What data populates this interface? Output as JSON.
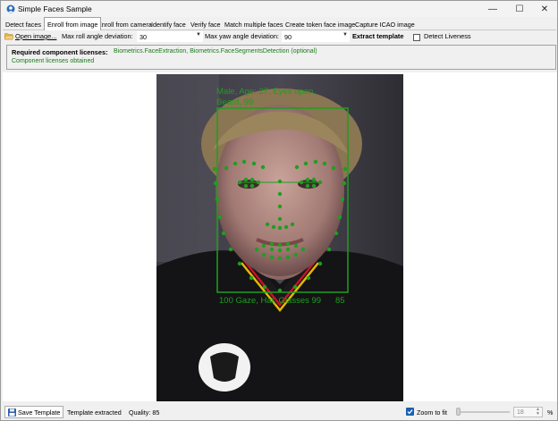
{
  "window": {
    "title": "Simple Faces Sample",
    "minimize": "—",
    "maximize": "☐",
    "close": "✕"
  },
  "tabs": [
    {
      "label": "Detect faces",
      "active": false
    },
    {
      "label": "Enroll from image",
      "active": true
    },
    {
      "label": "Enroll from camera",
      "active": false
    },
    {
      "label": "Identify face",
      "active": false
    },
    {
      "label": "Verify face",
      "active": false
    },
    {
      "label": "Match multiple faces",
      "active": false
    },
    {
      "label": "Create token face image",
      "active": false
    },
    {
      "label": "Capture ICAO image",
      "active": false
    }
  ],
  "toolbar": {
    "open_label": "Open image...",
    "roll_label": "Max roll angle deviation:",
    "roll_value": "30",
    "yaw_label": "Max yaw angle deviation:",
    "yaw_value": "90",
    "extract_label": "Extract template",
    "liveness_label": "Detect Liveness",
    "liveness_checked": false
  },
  "licenses": {
    "label": "Required component licenses:",
    "value": "Biometrics.FaceExtraction, Biometrics.FaceSegmentsDetection (optional)",
    "status": "Component licenses obtained",
    "status_color": "#1a7a1a"
  },
  "face_overlay": {
    "top_text_line1": "Male, Age: 27, Eyes open,",
    "top_text_line2": "Beard, 99",
    "bottom_text": "100 Gaze, Hat, Glasses 99",
    "bottom_score": "85",
    "overlay_color": "#1f9e1f"
  },
  "statusbar": {
    "save_label": "Save Template",
    "extracted_text": "Template extracted",
    "quality_text": "Quality: 85",
    "zoom_label": "Zoom to fit",
    "zoom_checked": true,
    "zoom_value": "18",
    "zoom_unit": "%"
  },
  "icons": {
    "app": "app-icon",
    "open": "folder-icon",
    "save": "floppy-disk-icon"
  }
}
